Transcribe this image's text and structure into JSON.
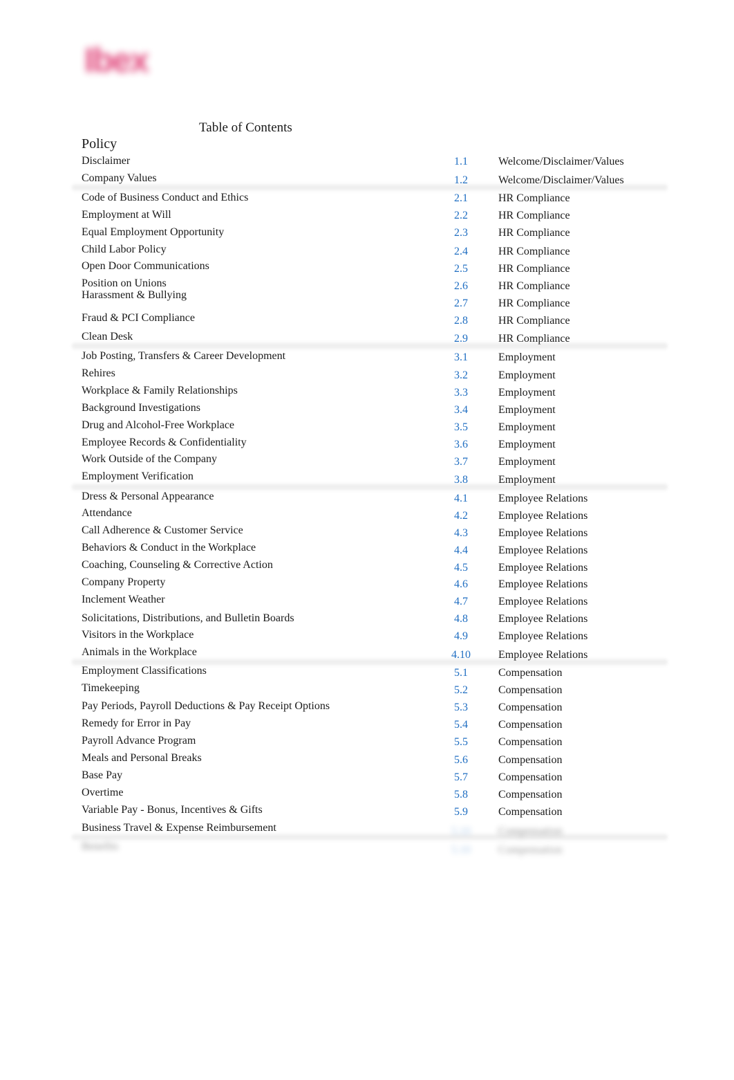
{
  "logo": {
    "text": "Ibex",
    "color": "#e0457a",
    "blurred": true
  },
  "title": "Table of Contents",
  "column_heading": "Policy",
  "colors": {
    "section_number": "#1f6ec2",
    "text": "#1a1a1a"
  },
  "sections": [
    {
      "category": "Welcome/Disclaimer/Values",
      "items": [
        {
          "title": "Disclaimer",
          "number": "1.1",
          "category": "Welcome/Disclaimer/Values"
        },
        {
          "title": "Company Values",
          "number": "1.2",
          "category": "Welcome/Disclaimer/Values"
        }
      ]
    },
    {
      "category": "HR Compliance",
      "items": [
        {
          "title": "Code of Business Conduct and Ethics",
          "number": "2.1",
          "category": "HR Compliance"
        },
        {
          "title": "Employment at Will",
          "number": "2.2",
          "category": "HR Compliance"
        },
        {
          "title": "Equal Employment Opportunity",
          "number": "2.3",
          "category": "HR Compliance"
        },
        {
          "title": "Child Labor Policy",
          "number": "2.4",
          "category": "HR Compliance"
        },
        {
          "title": "Open Door Communications",
          "number": "2.5",
          "category": "HR Compliance"
        },
        {
          "title": "Position on Unions",
          "number": "2.6",
          "category": "HR Compliance"
        },
        {
          "title": "Harassment & Bullying",
          "number": "2.7",
          "category": "HR Compliance"
        },
        {
          "title": "Fraud & PCI Compliance",
          "number": "2.8",
          "category": "HR Compliance"
        },
        {
          "title": "Clean Desk",
          "number": "2.9",
          "category": "HR Compliance"
        }
      ]
    },
    {
      "category": "Employment",
      "items": [
        {
          "title": "Job Posting, Transfers & Career Development",
          "number": "3.1",
          "category": "Employment"
        },
        {
          "title": "Rehires",
          "number": "3.2",
          "category": "Employment"
        },
        {
          "title": "Workplace & Family Relationships",
          "number": "3.3",
          "category": "Employment"
        },
        {
          "title": "Background Investigations",
          "number": "3.4",
          "category": "Employment"
        },
        {
          "title": "Drug and Alcohol-Free Workplace",
          "number": "3.5",
          "category": "Employment"
        },
        {
          "title": "Employee Records & Confidentiality",
          "number": "3.6",
          "category": "Employment"
        },
        {
          "title": "Work Outside of the Company",
          "number": "3.7",
          "category": "Employment"
        },
        {
          "title": "Employment Verification",
          "number": "3.8",
          "category": "Employment"
        }
      ]
    },
    {
      "category": "Employee Relations",
      "items": [
        {
          "title": "Dress & Personal Appearance",
          "number": "4.1",
          "category": "Employee Relations"
        },
        {
          "title": "Attendance",
          "number": "4.2",
          "category": "Employee Relations"
        },
        {
          "title": "Call Adherence & Customer Service",
          "number": "4.3",
          "category": "Employee Relations"
        },
        {
          "title": "Behaviors & Conduct in the Workplace",
          "number": "4.4",
          "category": "Employee Relations"
        },
        {
          "title": "Coaching, Counseling & Corrective Action",
          "number": "4.5",
          "category": "Employee Relations"
        },
        {
          "title": "Company Property",
          "number": "4.6",
          "category": "Employee Relations"
        },
        {
          "title": "Inclement Weather",
          "number": "4.7",
          "category": "Employee Relations"
        },
        {
          "title": "Solicitations, Distributions, and Bulletin Boards",
          "number": "4.8",
          "category": "Employee Relations"
        },
        {
          "title": "Visitors in the Workplace",
          "number": "4.9",
          "category": "Employee Relations"
        },
        {
          "title": "Animals in the Workplace",
          "number": "4.10",
          "category": "Employee Relations"
        }
      ]
    },
    {
      "category": "Compensation",
      "items": [
        {
          "title": "Employment Classifications",
          "number": "5.1",
          "category": "Compensation"
        },
        {
          "title": "Timekeeping",
          "number": "5.2",
          "category": "Compensation"
        },
        {
          "title": "Pay Periods, Payroll Deductions & Pay Receipt Options",
          "number": "5.3",
          "category": "Compensation"
        },
        {
          "title": "Remedy for Error in Pay",
          "number": "5.4",
          "category": "Compensation"
        },
        {
          "title": "Payroll Advance Program",
          "number": "5.5",
          "category": "Compensation"
        },
        {
          "title": "Meals and Personal Breaks",
          "number": "5.6",
          "category": "Compensation"
        },
        {
          "title": "Base Pay",
          "number": "5.7",
          "category": "Compensation"
        },
        {
          "title": "Overtime",
          "number": "5.8",
          "category": "Compensation"
        },
        {
          "title": "Variable Pay - Bonus, Incentives & Gifts",
          "number": "5.9",
          "category": "Compensation"
        },
        {
          "title": "Business Travel & Expense Reimbursement",
          "number": "",
          "category": "",
          "blurred_right": true
        }
      ]
    },
    {
      "category": "",
      "blurred": true,
      "items": [
        {
          "title": "",
          "number": "",
          "category": "",
          "blurred": true
        }
      ]
    }
  ]
}
